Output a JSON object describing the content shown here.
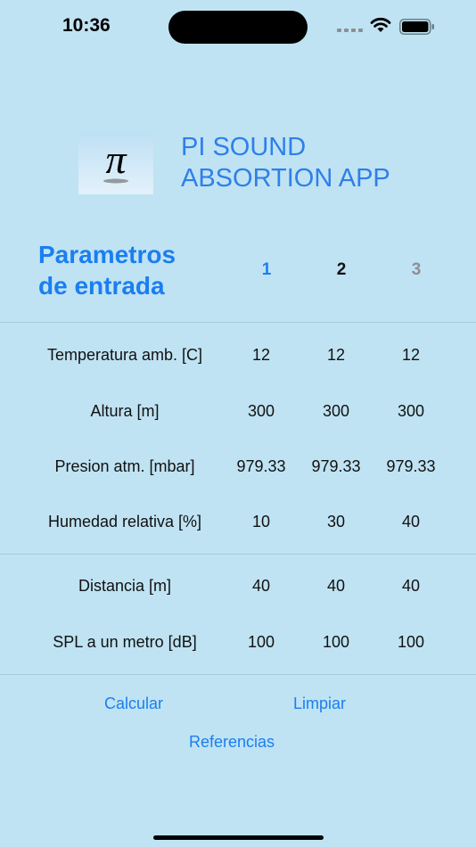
{
  "status_bar": {
    "time": "10:36"
  },
  "header": {
    "logo_glyph": "π",
    "title_line1": "PI SOUND",
    "title_line2": "ABSORTION APP"
  },
  "parameters": {
    "title_line1": "Parametros",
    "title_line2": "de entrada",
    "columns": [
      "1",
      "2",
      "3"
    ],
    "rows": [
      {
        "label": "Temperatura amb. [C]",
        "values": [
          "12",
          "12",
          "12"
        ]
      },
      {
        "label": "Altura [m]",
        "values": [
          "300",
          "300",
          "300"
        ]
      },
      {
        "label": "Presion atm. [mbar]",
        "values": [
          "979.33",
          "979.33",
          "979.33"
        ]
      },
      {
        "label": "Humedad relativa [%]",
        "values": [
          "10",
          "30",
          "40"
        ]
      },
      {
        "label": "Distancia [m]",
        "values": [
          "40",
          "40",
          "40"
        ]
      },
      {
        "label": "SPL a un metro [dB]",
        "values": [
          "100",
          "100",
          "100"
        ]
      }
    ]
  },
  "actions": {
    "calculate": "Calcular",
    "clear": "Limpiar",
    "references": "Referencias"
  },
  "colors": {
    "background": "#bfe3f3",
    "accent": "#1b7ef0",
    "inactive": "#8e8e93"
  },
  "icons": [
    "signal-icon",
    "wifi-icon",
    "battery-icon",
    "pi-logo-icon"
  ]
}
